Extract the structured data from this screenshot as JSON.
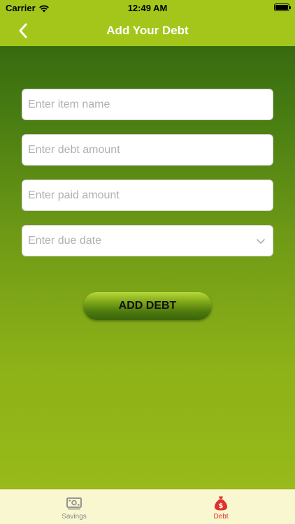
{
  "status_bar": {
    "carrier": "Carrier",
    "time": "12:49 AM",
    "wifi_icon": "wifi-icon",
    "battery_icon": "battery-icon"
  },
  "nav": {
    "title": "Add Your Debt",
    "back_icon": "chevron-left-icon"
  },
  "form": {
    "item_name_placeholder": "Enter item name",
    "debt_amount_placeholder": "Enter debt amount",
    "paid_amount_placeholder": "Enter paid amount",
    "due_date_placeholder": "Enter due date",
    "due_date_icon": "chevron-down-icon",
    "submit_label": "ADD DEBT"
  },
  "tabs": [
    {
      "label": "Savings",
      "icon": "money-icon",
      "active": false
    },
    {
      "label": "Debt",
      "icon": "debt-bag-icon",
      "active": true
    }
  ],
  "colors": {
    "nav_bar": "#a4c61a",
    "active_tab": "#e0322a",
    "inactive_tab": "#8a8a8a",
    "tab_bar": "#f8f7cf"
  }
}
